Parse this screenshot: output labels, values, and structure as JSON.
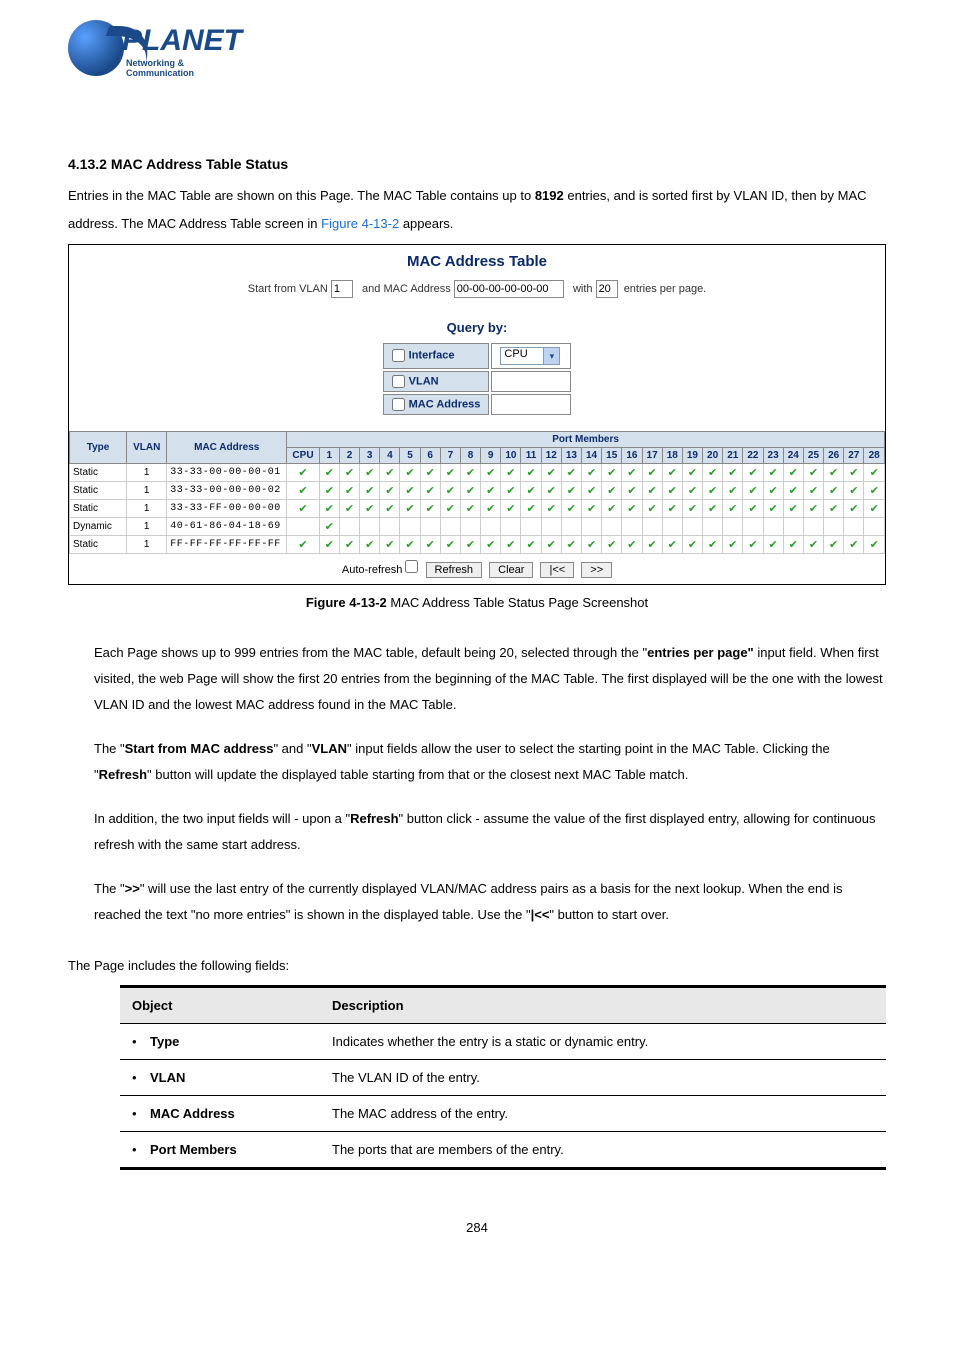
{
  "logo": {
    "brand": "PLANET",
    "tagline": "Networking & Communication"
  },
  "section_heading": "4.13.2 MAC Address Table Status",
  "intro": {
    "line1_a": "Entries in the MAC Table are shown on this Page. The MAC Table contains up to ",
    "line1_b": "8192",
    "line1_c": " entries, and is sorted first by VLAN ID,",
    "line2_a": "then by MAC address. The MAC Address Table screen in ",
    "fig_ref": "Figure 4-13-2",
    "line2_b": " appears."
  },
  "screenshot": {
    "title": "MAC Address Table",
    "start_label_a": "Start from VLAN",
    "vlan_value": "1",
    "start_label_b": "and MAC Address",
    "mac_value": "00-00-00-00-00-00",
    "with_label": "with",
    "entries_value": "20",
    "entries_label": "entries per page.",
    "query_title": "Query by:",
    "query_rows": {
      "interface": "Interface",
      "vlan": "VLAN",
      "mac": "MAC Address",
      "select_value": "CPU"
    },
    "headers": {
      "type": "Type",
      "vlan": "VLAN",
      "mac": "MAC Address",
      "port_members": "Port Members",
      "cpu": "CPU"
    },
    "ports": [
      "1",
      "2",
      "3",
      "4",
      "5",
      "6",
      "7",
      "8",
      "9",
      "10",
      "11",
      "12",
      "13",
      "14",
      "15",
      "16",
      "17",
      "18",
      "19",
      "20",
      "21",
      "22",
      "23",
      "24",
      "25",
      "26",
      "27",
      "28"
    ],
    "rows": [
      {
        "type": "Static",
        "vlan": "1",
        "mac": "33-33-00-00-00-01",
        "cpu": true,
        "all": true,
        "p1": false
      },
      {
        "type": "Static",
        "vlan": "1",
        "mac": "33-33-00-00-00-02",
        "cpu": true,
        "all": true,
        "p1": false
      },
      {
        "type": "Static",
        "vlan": "1",
        "mac": "33-33-FF-00-00-00",
        "cpu": true,
        "all": true,
        "p1": false
      },
      {
        "type": "Dynamic",
        "vlan": "1",
        "mac": "40-61-86-04-18-69",
        "cpu": false,
        "all": false,
        "p1": true
      },
      {
        "type": "Static",
        "vlan": "1",
        "mac": "FF-FF-FF-FF-FF-FF",
        "cpu": true,
        "all": true,
        "p1": false
      }
    ],
    "footer": {
      "auto_refresh": "Auto-refresh",
      "refresh": "Refresh",
      "clear": "Clear",
      "first": "|<<",
      "next": ">>"
    }
  },
  "caption": {
    "prefix": "Figure 4-13-2",
    "text": " MAC Address Table Status Page Screenshot"
  },
  "desc": {
    "p1a": "Each Page shows up to 999 entries from the MAC table, default being 20, selected through the \"",
    "p1b": "entries per page\"",
    "p1c": " input field. When first visited, the web Page will show the first 20 entries from the beginning of the MAC Table. The first displayed will be the one with the lowest VLAN ID and the lowest MAC address found in the MAC Table.",
    "p2a": "The \"",
    "p2b": "Start from MAC address",
    "p2c": "\" and \"",
    "p2d": "VLAN",
    "p2e": "\" input fields allow the user to select the starting point in the MAC Table. Clicking the \"",
    "p2f": "Refresh",
    "p2g": "\" button will update the displayed table starting from that or the closest next MAC Table match.",
    "p3a": "In addition, the two input fields will - upon a \"",
    "p3b": "Refresh",
    "p3c": "\" button click - assume the value of the first displayed entry, allowing for continuous refresh with the same start address.",
    "p4a": "The \"",
    "p4b": ">>",
    "p4c": "\" will use the last entry of the currently displayed VLAN/MAC address pairs as a basis for the next lookup. When the end is reached the text \"no more entries\" is shown in the displayed table. Use the \"",
    "p4d": "|<<",
    "p4e": "\" button to start over."
  },
  "fields_intro": "The Page includes the following fields:",
  "fields_table": {
    "h1": "Object",
    "h2": "Description",
    "rows": [
      {
        "obj": "Type",
        "desc": "Indicates whether the entry is a static or dynamic entry."
      },
      {
        "obj": "VLAN",
        "desc": "The VLAN ID of the entry."
      },
      {
        "obj": "MAC Address",
        "desc": "The MAC address of the entry."
      },
      {
        "obj": "Port Members",
        "desc": "The ports that are members of the entry."
      }
    ]
  },
  "page_number": "284"
}
